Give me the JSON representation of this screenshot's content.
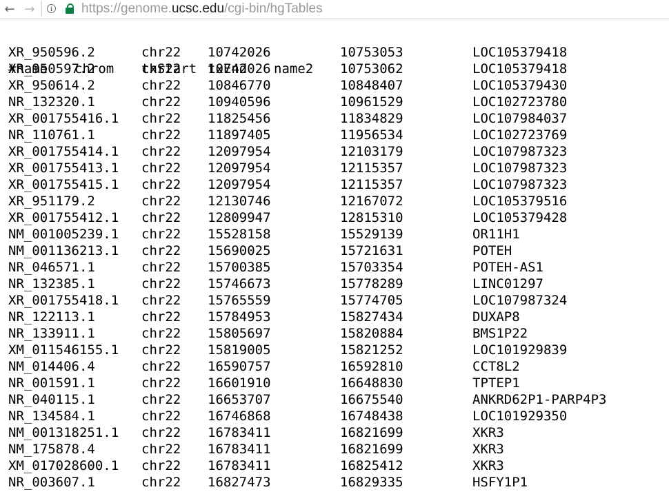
{
  "browser": {
    "back_icon": "arrow-left-icon",
    "forward_icon": "arrow-right-icon",
    "info_icon": "info-icon",
    "lock_icon": "lock-icon",
    "url_scheme": "https://",
    "url_domain_pre": "genome.",
    "url_domain": "ucsc.edu",
    "url_path": "/cgi-bin/hgTables",
    "lock_color": "#0b8043"
  },
  "table": {
    "headers": [
      "#name",
      "chrom",
      "txStart",
      "txEnd",
      "name2"
    ],
    "rows": [
      [
        "XR_950596.2",
        "chr22",
        "10742026",
        "10753053",
        "LOC105379418"
      ],
      [
        "XR_950597.2",
        "chr22",
        "10742026",
        "10753062",
        "LOC105379418"
      ],
      [
        "XR_950614.2",
        "chr22",
        "10846770",
        "10848407",
        "LOC105379430"
      ],
      [
        "NR_132320.1",
        "chr22",
        "10940596",
        "10961529",
        "LOC102723780"
      ],
      [
        "XR_001755416.1",
        "chr22",
        "11825456",
        "11834829",
        "LOC107984037"
      ],
      [
        "NR_110761.1",
        "chr22",
        "11897405",
        "11956534",
        "LOC102723769"
      ],
      [
        "XR_001755414.1",
        "chr22",
        "12097954",
        "12103179",
        "LOC107987323"
      ],
      [
        "XR_001755413.1",
        "chr22",
        "12097954",
        "12115357",
        "LOC107987323"
      ],
      [
        "XR_001755415.1",
        "chr22",
        "12097954",
        "12115357",
        "LOC107987323"
      ],
      [
        "XR_951179.2",
        "chr22",
        "12130746",
        "12167072",
        "LOC105379516"
      ],
      [
        "XR_001755412.1",
        "chr22",
        "12809947",
        "12815310",
        "LOC105379428"
      ],
      [
        "NM_001005239.1",
        "chr22",
        "15528158",
        "15529139",
        "OR11H1"
      ],
      [
        "NM_001136213.1",
        "chr22",
        "15690025",
        "15721631",
        "POTEH"
      ],
      [
        "NR_046571.1",
        "chr22",
        "15700385",
        "15703354",
        "POTEH-AS1"
      ],
      [
        "NR_132385.1",
        "chr22",
        "15746673",
        "15778289",
        "LINC01297"
      ],
      [
        "XR_001755418.1",
        "chr22",
        "15765559",
        "15774705",
        "LOC107987324"
      ],
      [
        "NR_122113.1",
        "chr22",
        "15784953",
        "15827434",
        "DUXAP8"
      ],
      [
        "NR_133911.1",
        "chr22",
        "15805697",
        "15820884",
        "BMS1P22"
      ],
      [
        "XM_011546155.1",
        "chr22",
        "15819005",
        "15821252",
        "LOC101929839"
      ],
      [
        "NM_014406.4",
        "chr22",
        "16590757",
        "16592810",
        "CCT8L2"
      ],
      [
        "NR_001591.1",
        "chr22",
        "16601910",
        "16648830",
        "TPTEP1"
      ],
      [
        "NR_040115.1",
        "chr22",
        "16653707",
        "16675540",
        "ANKRD62P1-PARP4P3"
      ],
      [
        "NR_134584.1",
        "chr22",
        "16746868",
        "16748438",
        "LOC101929350"
      ],
      [
        "NM_001318251.1",
        "chr22",
        "16783411",
        "16821699",
        "XKR3"
      ],
      [
        "NM_175878.4",
        "chr22",
        "16783411",
        "16821699",
        "XKR3"
      ],
      [
        "XM_017028600.1",
        "chr22",
        "16783411",
        "16825412",
        "XKR3"
      ],
      [
        "NR_003607.1",
        "chr22",
        "16827473",
        "16829335",
        "HSFY1P1"
      ]
    ]
  }
}
